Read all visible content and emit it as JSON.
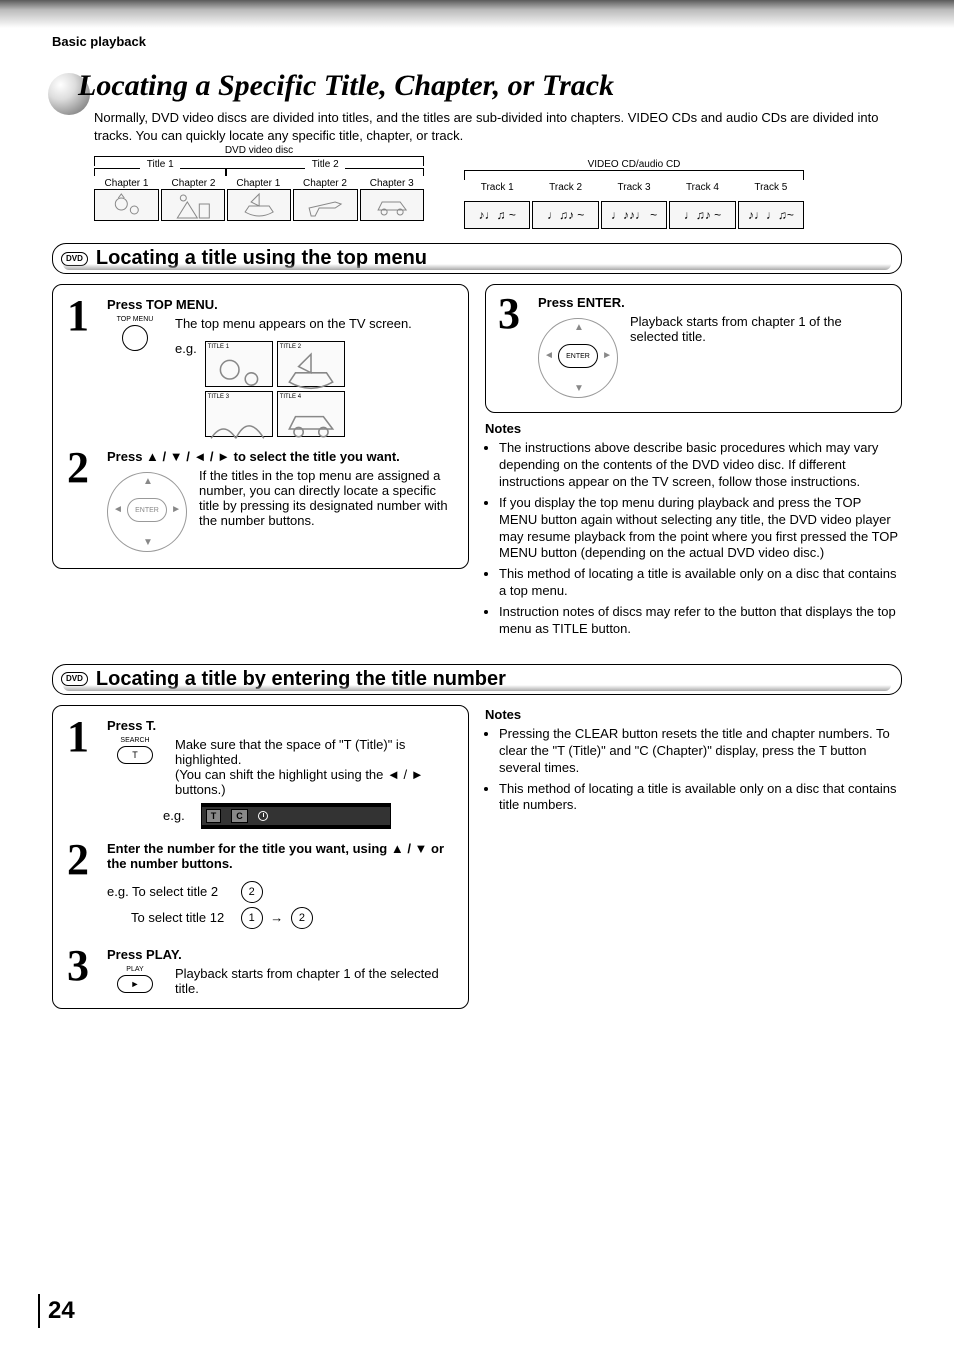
{
  "breadcrumb": "Basic playback",
  "page_title": "Locating a Specific Title, Chapter, or Track",
  "intro": "Normally, DVD video discs are divided into titles, and the titles are sub-divided into chapters. VIDEO CDs and audio CDs are divided into tracks. You can quickly locate any specific title, chapter, or track.",
  "diagram_dvd": {
    "label": "DVD video disc",
    "title1": "Title 1",
    "title2": "Title 2",
    "chapters1": [
      "Chapter 1",
      "Chapter 2"
    ],
    "chapters2": [
      "Chapter 1",
      "Chapter 2",
      "Chapter 3"
    ]
  },
  "diagram_cd": {
    "label": "VIDEO CD/audio CD",
    "tracks": [
      "Track 1",
      "Track 2",
      "Track 3",
      "Track 4",
      "Track 5"
    ]
  },
  "section1": {
    "badge": "DVD",
    "heading": "Locating a title using the top menu",
    "step1": {
      "title": "Press TOP MENU.",
      "btn_label": "TOP MENU",
      "desc": "The top menu appears on the TV screen.",
      "eg": "e.g.",
      "tiles": [
        "TITLE 1",
        "TITLE 2",
        "TITLE 3",
        "TITLE 4"
      ]
    },
    "step2": {
      "title_pre": "Press ",
      "title_arrows": "▲ / ▼ / ◄ / ►",
      "title_post": " to select the title you want.",
      "dpad_center": "ENTER",
      "desc": "If the titles in the top menu are assigned a number, you can directly locate a specific title by pressing its designated number with the number buttons."
    },
    "step3": {
      "title": "Press ENTER.",
      "dpad_center": "ENTER",
      "desc": "Playback starts from chapter 1 of the selected title."
    },
    "notes_title": "Notes",
    "notes": [
      "The instructions above describe basic procedures which may vary depending on the contents of the DVD video disc. If different instructions appear on the TV screen, follow those instructions.",
      "If you display the top menu during playback and press the TOP MENU button again without selecting any title, the DVD video player may resume playback from the point where you first pressed the TOP MENU button (depending on the actual DVD video disc.)",
      "This method of locating a title is available only on a disc that contains a top menu.",
      "Instruction notes of discs may refer to the button that displays the top menu as TITLE button."
    ]
  },
  "section2": {
    "badge": "DVD",
    "heading": "Locating a title by entering the title number",
    "step1": {
      "title": "Press T.",
      "btn_top": "SEARCH",
      "btn_label": "T",
      "desc1": "Make sure that the space of \"T (Title)\" is highlighted.",
      "desc2_pre": "(You can shift the highlight using the ",
      "desc2_arrows": "◄ / ►",
      "desc2_post": " buttons.)",
      "eg": "e.g.",
      "osd": {
        "T": "T",
        "C": "C"
      }
    },
    "step2": {
      "title_pre": "Enter the number for the title you want, using ",
      "title_arrows": "▲ / ▼",
      "title_post": " or the number buttons.",
      "eg_line1_label": "e.g. To select title 2",
      "eg_line1_btn": "2",
      "eg_line2_label": "To select title 12",
      "eg_line2_btn1": "1",
      "eg_line2_btn2": "2"
    },
    "step3": {
      "title": "Press PLAY.",
      "btn_top": "PLAY",
      "btn_glyph": "►",
      "desc": "Playback starts from chapter 1 of the selected title."
    },
    "notes_title": "Notes",
    "notes": [
      "Pressing the CLEAR button resets the title and chapter numbers. To clear the \"T (Title)\" and \"C (Chapter)\" display, press the T button several times.",
      "This method of locating a title is available only on a disc that contains title numbers."
    ]
  },
  "page_number": "24"
}
